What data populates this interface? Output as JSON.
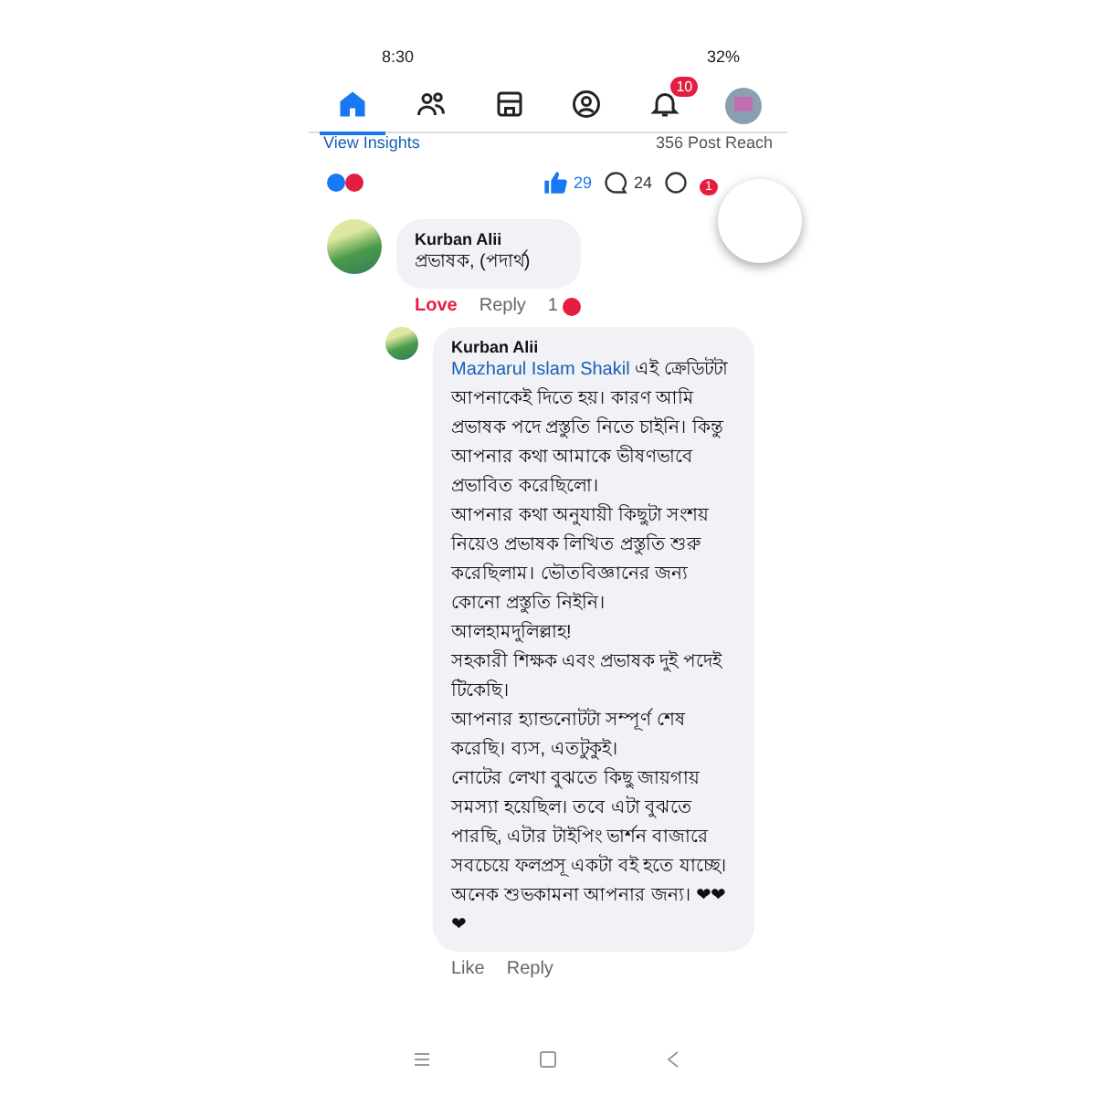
{
  "status_bar": {
    "time": "8:30",
    "battery": "32%"
  },
  "nav_tabs": [
    {
      "kind": "home",
      "selected": true
    },
    {
      "kind": "friends",
      "selected": false
    },
    {
      "kind": "market",
      "selected": false
    },
    {
      "kind": "profile",
      "selected": false
    },
    {
      "kind": "bell",
      "selected": false,
      "badge": "10"
    },
    {
      "kind": "avatar",
      "selected": false
    }
  ],
  "insights": {
    "link": "View Insights",
    "reach": "356 Post Reach"
  },
  "post_stats": {
    "likes": "29",
    "comments": "24",
    "share_badge": "1"
  },
  "comments": [
    {
      "author": "Kurban Alii",
      "text": "প্রভাষক, (পদার্থ)",
      "actions": [
        {
          "label": "Love",
          "selected": true
        },
        {
          "label": "Reply",
          "selected": false
        }
      ],
      "reaction_count": "1",
      "replies": [
        {
          "author": "Kurban Alii",
          "mention": "Mazharul Islam Shakil",
          "paragraphs": [
            "এই ক্রেডিটটা আপনাকেই দিতে হয়। কারণ আমি প্রভাষক পদে প্রস্তুতি নিতে চাইনি। কিন্তু আপনার কথা আমাকে ভীষণভাবে প্রভাবিত করেছিলো।",
            "আপনার কথা অনুযায়ী কিছুটা সংশয় নিয়েও প্রভাষক লিখিত প্রস্তুতি শুরু করেছিলাম। ভৌতবিজ্ঞানের জন্য কোনো প্রস্তুতি নিইনি।",
            "আলহামদুলিল্লাহ!",
            "সহকারী শিক্ষক এবং প্রভাষক দুই পদেই টিকেছি।",
            "আপনার হ্যান্ডনোটটা সম্পূর্ণ শেষ করেছি। ব্যস, এতটুকুই।",
            "নোটের লেখা বুঝতে কিছু জায়গায় সমস্যা হয়েছিল।  তবে এটা বুঝতে পারছি, এটার টাইপিং ভার্শন বাজারে সবচেয়ে ফলপ্রসূ একটা বই হতে যাচ্ছে।  অনেক শুভকামনা আপনার জন্য। ❤❤❤"
          ],
          "actions": [
            {
              "label": "Like",
              "selected": false
            },
            {
              "label": "Reply",
              "selected": false
            }
          ]
        }
      ]
    }
  ]
}
